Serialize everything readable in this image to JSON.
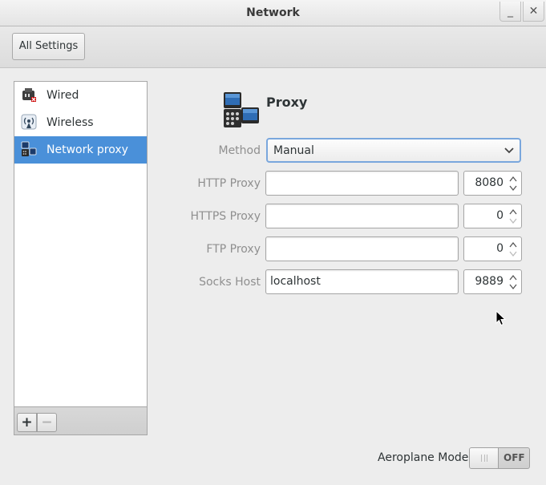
{
  "window": {
    "title": "Network",
    "minimize_glyph": "_",
    "close_glyph": "✕"
  },
  "toolbar": {
    "all_settings_label": "All Settings"
  },
  "sidebar": {
    "items": [
      {
        "label": "Wired",
        "icon": "wired-ethernet-icon",
        "selected": false
      },
      {
        "label": "Wireless",
        "icon": "wireless-icon",
        "selected": false
      },
      {
        "label": "Network proxy",
        "icon": "network-proxy-icon",
        "selected": true
      }
    ],
    "add_glyph": "+",
    "remove_glyph": "−"
  },
  "proxy": {
    "heading": "Proxy",
    "method_label": "Method",
    "method_value": "Manual",
    "rows": [
      {
        "label": "HTTP Proxy",
        "host": "",
        "port": "8080"
      },
      {
        "label": "HTTPS Proxy",
        "host": "",
        "port": "0"
      },
      {
        "label": "FTP Proxy",
        "host": "",
        "port": "0"
      },
      {
        "label": "Socks Host",
        "host": "localhost",
        "port": "9889"
      }
    ]
  },
  "aeroplane": {
    "label": "Aeroplane Mode",
    "state": "OFF"
  },
  "colors": {
    "selection": "#4a90d9",
    "focus_border": "#7aa7dd"
  }
}
